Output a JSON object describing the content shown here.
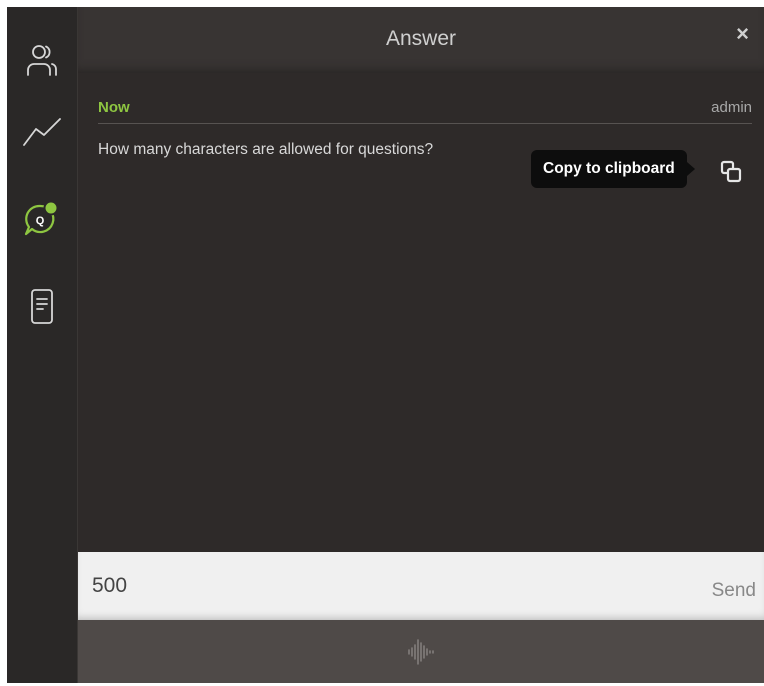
{
  "sidebar": {
    "items": [
      {
        "icon": "users-icon"
      },
      {
        "icon": "chart-line-icon"
      },
      {
        "icon": "qa-chat-icon",
        "badge_color": "#8ec641",
        "active": true
      },
      {
        "icon": "document-icon"
      }
    ]
  },
  "header": {
    "title": "Answer",
    "close_label": "×"
  },
  "message": {
    "time": "Now",
    "author": "admin",
    "text": "How many characters are allowed for questions?",
    "tooltip": "Copy to clipboard"
  },
  "composer": {
    "value": "500",
    "send_label": "Send"
  },
  "colors": {
    "accent": "#8ec641",
    "background": "#2e2a29"
  }
}
